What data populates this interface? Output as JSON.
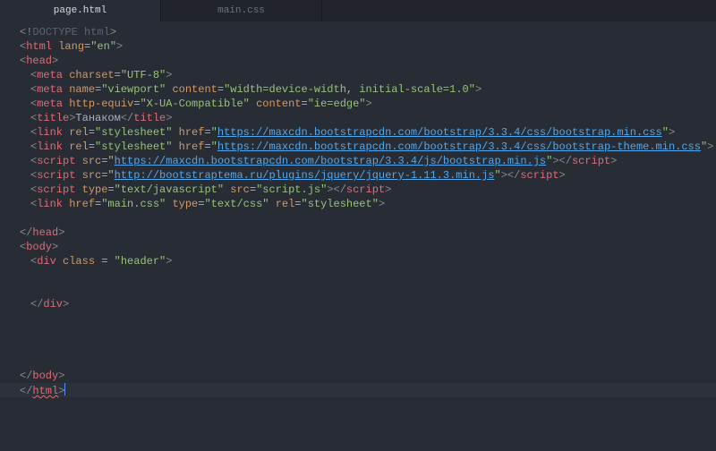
{
  "tabs": {
    "active": "page.html",
    "other": "main.css"
  },
  "code": {
    "l1": {
      "p1": "<!",
      "t": "DOCTYPE html",
      "p2": ">"
    },
    "l2": {
      "p1": "<",
      "t": "html",
      "sp": " ",
      "a": "lang",
      "eq": "=",
      "v": "\"en\"",
      "p2": ">"
    },
    "l3": {
      "p1": "<",
      "t": "head",
      "p2": ">"
    },
    "l4": {
      "p1": "<",
      "t": "meta",
      "sp": " ",
      "a": "charset",
      "eq": "=",
      "v": "\"UTF-8\"",
      "p2": ">"
    },
    "l5": {
      "p1": "<",
      "t": "meta",
      "sp": " ",
      "a1": "name",
      "v1": "\"viewport\"",
      "a2": "content",
      "v2": "\"width=device-width, initial-scale=1.0\"",
      "eq": "=",
      "p2": ">"
    },
    "l6": {
      "p1": "<",
      "t": "meta",
      "sp": " ",
      "a1": "http-equiv",
      "v1": "\"X-UA-Compatible\"",
      "a2": "content",
      "v2": "\"ie=edge\"",
      "eq": "=",
      "p2": ">"
    },
    "l7": {
      "p1": "<",
      "t": "title",
      "p2": ">",
      "tx": "Танаком",
      "p3": "</",
      "t2": "title",
      "p4": ">"
    },
    "l8": {
      "p1": "<",
      "t": "link",
      "a1": "rel",
      "v1": "\"stylesheet\"",
      "a2": "href",
      "q": "\"",
      "url": "https://maxcdn.bootstrapcdn.com/bootstrap/3.3.4/css/bootstrap.min.css",
      "eq": "=",
      "p2": ">"
    },
    "l9": {
      "p1": "<",
      "t": "link",
      "a1": "rel",
      "v1": "\"stylesheet\"",
      "a2": "href",
      "q": "\"",
      "url": "https://maxcdn.bootstrapcdn.com/bootstrap/3.3.4/css/bootstrap-theme.min.css",
      "eq": "=",
      "p2": ">"
    },
    "l10": {
      "p1": "<",
      "t": "script",
      "a": "src",
      "q": "\"",
      "url": "https://maxcdn.bootstrapcdn.com/bootstrap/3.3.4/js/bootstrap.min.js",
      "eq": "=",
      "p2": ">",
      "p3": "</",
      "t2": "script",
      "p4": ">"
    },
    "l11": {
      "p1": "<",
      "t": "script",
      "a": "src",
      "q": "\"",
      "url": "http://bootstraptema.ru/plugins/jquery/jquery-1.11.3.min.js",
      "eq": "=",
      "p2": ">",
      "p3": "</",
      "t2": "script",
      "p4": ">"
    },
    "l12": {
      "p1": "<",
      "t": "script",
      "a1": "type",
      "v1": "\"text/javascript\"",
      "a2": "src",
      "v2": "\"script.js\"",
      "eq": "=",
      "p2": ">",
      "p3": "</",
      "t2": "script",
      "p4": ">"
    },
    "l13": {
      "p1": "<",
      "t": "link",
      "a1": "href",
      "v1": "\"main.css\"",
      "a2": "type",
      "v2": "\"text/css\"",
      "a3": "rel",
      "v3": "\"stylesheet\"",
      "eq": "=",
      "p2": ">"
    },
    "l14": {
      "p1": "</",
      "t": "head",
      "p2": ">"
    },
    "l15": {
      "p1": "<",
      "t": "body",
      "p2": ">"
    },
    "l16": {
      "p1": "<",
      "t": "div",
      "a": "class",
      "eq": " = ",
      "v": "\"header\"",
      "p2": ">"
    },
    "l17": {
      "p1": "</",
      "t": "div",
      "p2": ">"
    },
    "l18": {
      "p1": "</",
      "t": "body",
      "p2": ">"
    },
    "l19": {
      "p1": "</",
      "t": "html",
      "p2": ">"
    }
  }
}
